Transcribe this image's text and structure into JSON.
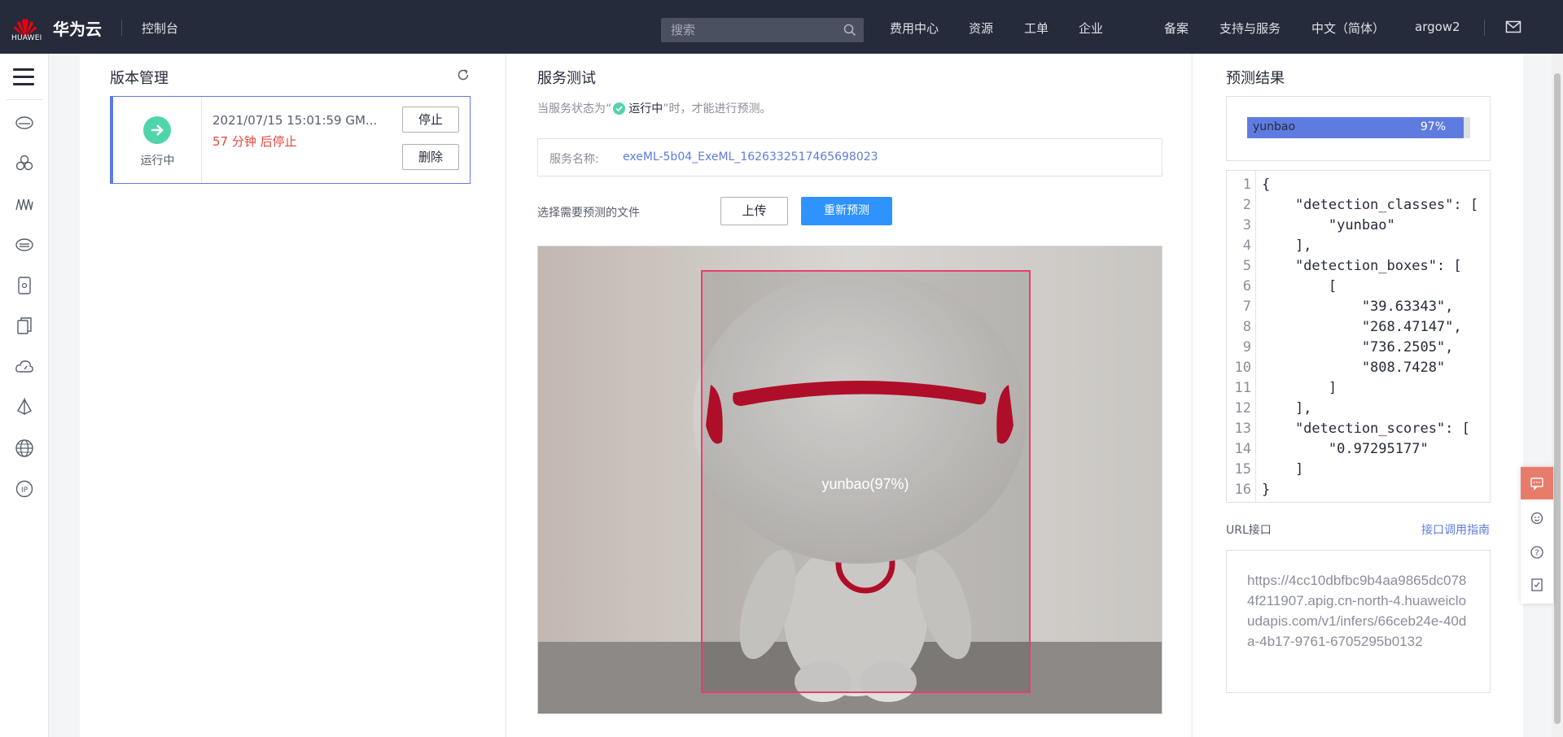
{
  "topbar": {
    "logo_text": "HUAWEI",
    "brand": "华为云",
    "console": "控制台",
    "search_placeholder": "搜索",
    "nav": [
      "费用中心",
      "资源",
      "工单",
      "企业",
      "备案",
      "支持与服务",
      "中文（简体）",
      "argow2"
    ],
    "mail_icon": "mail-icon"
  },
  "sidebar": {
    "icons": [
      "menu-icon",
      "cloud-server-icon",
      "cluster-icon",
      "waves-icon",
      "cloud-drive-icon",
      "tablet-icon",
      "copy-icon",
      "cloud-gauge-icon",
      "sail-icon",
      "globe-icon",
      "ip-icon"
    ]
  },
  "version": {
    "title": "版本管理",
    "status": "运行中",
    "date": "2021/07/15 15:01:59 GM...",
    "countdown": "57 分钟 后停止",
    "stop": "停止",
    "delete": "删除"
  },
  "service": {
    "title": "服务测试",
    "hint_before": "当服务状态为“",
    "hint_status": "运行中",
    "hint_after": "”时，才能进行预测。",
    "name_label": "服务名称:",
    "name_value": "exeML-5b04_ExeML_1626332517465698023",
    "file_label": "选择需要预测的文件",
    "upload": "上传",
    "repredict": "重新预测",
    "box_label": "yunbao(97%)"
  },
  "result": {
    "title": "预测结果",
    "bar_label": "yunbao",
    "bar_pct_text": "97%",
    "bar_fraction": 0.97,
    "code_lines": [
      "{",
      "    \"detection_classes\": [",
      "        \"yunbao\"",
      "    ],",
      "    \"detection_boxes\": [",
      "        [",
      "            \"39.63343\",",
      "            \"268.47147\",",
      "            \"736.2505\",",
      "            \"808.7428\"",
      "        ]",
      "    ],",
      "    \"detection_scores\": [",
      "        \"0.97295177\"",
      "    ]",
      "}"
    ],
    "url_label": "URL接口",
    "url_guide": "接口调用指南",
    "url": "https://4cc10dbfbc9b4aa9865dc0784f211907.apig.cn-north-4.huaweicloudapis.com/v1/infers/66ceb24e-40da-4b17-9761-6705295b0132"
  },
  "float_toolbar": [
    "chat-icon",
    "robot-icon",
    "help-icon",
    "feedback-icon"
  ],
  "colors": {
    "topbar": "#252b3a",
    "accent": "#5e7ce0",
    "primary_button": "#2f93ff",
    "running": "#50d4ab",
    "warning": "#e2483d",
    "box": "#e8406b"
  }
}
